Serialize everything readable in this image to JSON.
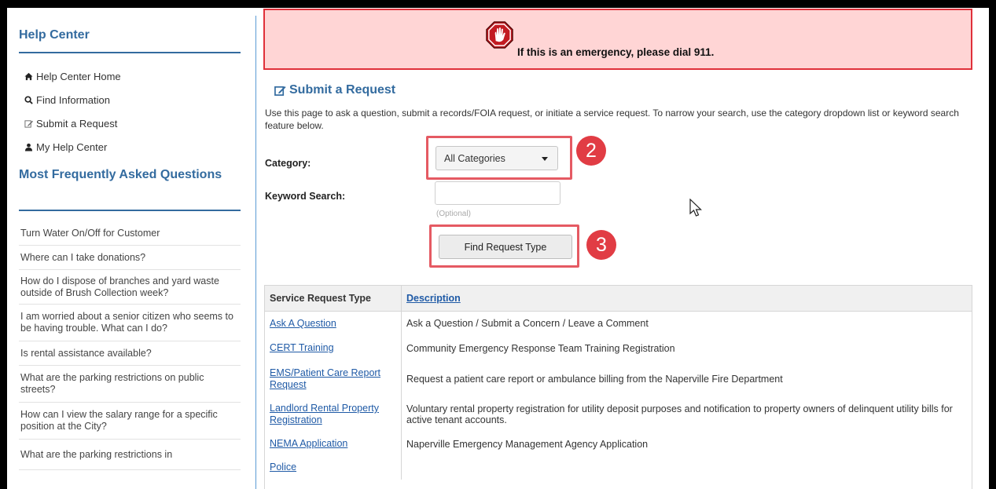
{
  "sidebar": {
    "title": "Help Center",
    "links": [
      {
        "label": "Help Center Home",
        "icon": "home-icon"
      },
      {
        "label": "Find Information",
        "icon": "search-icon"
      },
      {
        "label": "Submit a Request",
        "icon": "edit-icon"
      },
      {
        "label": "My Help Center",
        "icon": "user-icon"
      }
    ],
    "faq_title": "Most Frequently Asked Questions",
    "faq": [
      "Turn Water On/Off for Customer",
      "Where can I take donations?",
      "How do I dispose of branches and yard waste outside of Brush Collection week?",
      "I am worried about a senior citizen who seems to be having trouble. What can I do?",
      "Is rental assistance available?",
      "What are the parking restrictions on public streets?",
      "How can I view the salary range for a specific position at the City?",
      "What are the parking restrictions in"
    ]
  },
  "emergency": {
    "text": "If this is an emergency, please dial 911.",
    "icon": "stop-hand-icon"
  },
  "request": {
    "title": "Submit a Request",
    "intro": "Use this page to ask a question, submit a records/FOIA request, or initiate a service request. To narrow your search, use the category dropdown list or keyword search feature below.",
    "category_label": "Category:",
    "category_value": "All Categories",
    "keyword_label": "Keyword Search:",
    "keyword_value": "",
    "keyword_hint": "(Optional)",
    "find_button": "Find Request Type",
    "badge_category": "2",
    "badge_find": "3"
  },
  "table": {
    "headers": [
      "Service Request Type",
      "Description"
    ],
    "rows": [
      {
        "type": "Ask A Question",
        "description": "Ask a Question / Submit a Concern / Leave a Comment"
      },
      {
        "type": "CERT Training",
        "description": "Community Emergency Response Team Training Registration"
      },
      {
        "type": "EMS/Patient Care Report Request",
        "description": "Request a patient care report or ambulance billing from the Naperville Fire Department"
      },
      {
        "type": "Landlord Rental Property Registration",
        "description": "Voluntary rental property registration for utility deposit purposes and notification to property owners of delinquent utility bills for active tenant accounts."
      },
      {
        "type": "NEMA Application",
        "description": "Naperville Emergency Management Agency Application"
      },
      {
        "type": "Police",
        "description": ""
      }
    ]
  },
  "colors": {
    "accent": "#336b9f",
    "alert_bg": "#ffd5d5",
    "alert_border": "#e0303a",
    "highlight": "#e55a63",
    "link": "#1f5aa6"
  }
}
